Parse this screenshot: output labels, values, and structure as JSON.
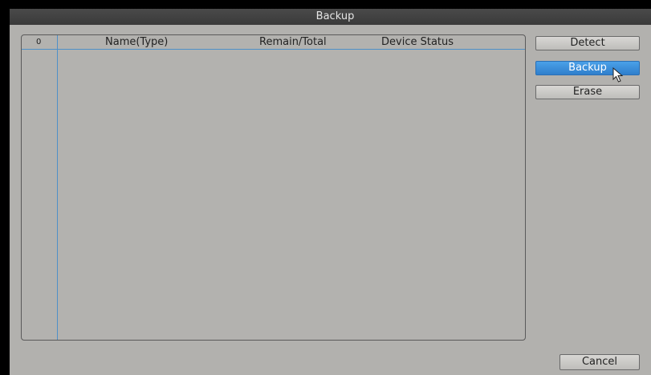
{
  "window": {
    "title": "Backup"
  },
  "device_list": {
    "columns": {
      "index": "0",
      "name": "Name(Type)",
      "remain_total": "Remain/Total",
      "device_status": "Device Status"
    },
    "rows": []
  },
  "buttons": {
    "detect": "Detect",
    "backup": "Backup",
    "erase": "Erase",
    "cancel": "Cancel"
  },
  "colors": {
    "accent": "#3a8ad8",
    "background": "#b2b1ae",
    "titlebar": "#404040"
  },
  "icons": {
    "cursor": "mouse-pointer-icon"
  }
}
